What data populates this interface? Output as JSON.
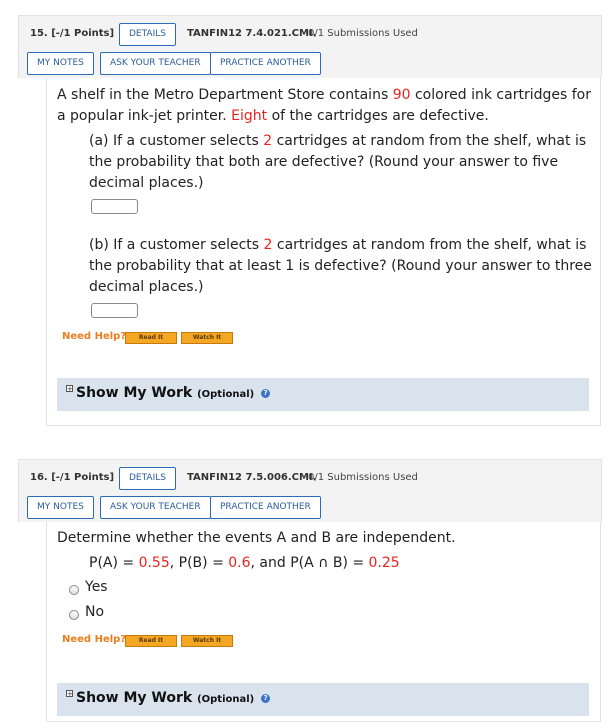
{
  "q15": {
    "number": "15.",
    "points": "[-/1 Points]",
    "details": "DETAILS",
    "code": "TANFIN12 7.4.021.CMI.",
    "submissions": "0/1 Submissions Used",
    "my_notes": "MY NOTES",
    "ask_teacher": "ASK YOUR TEACHER",
    "practice": "PRACTICE ANOTHER",
    "p1_a": "A shelf in the Metro Department Store contains ",
    "p1_num": "90",
    "p1_b": " colored ink cartridges for",
    "p2_a": "a popular ink-jet printer. ",
    "p2_num": "Eight",
    "p2_b": " of the cartridges are defective.",
    "a_line1_a": "(a) If a customer selects ",
    "a_line1_num": "2",
    "a_line1_b": " cartridges at random from the shelf, what is",
    "a_line2": "the probability that both are defective? (Round your answer to five",
    "a_line3": "decimal places.)",
    "b_line1_a": "(b) If a customer selects ",
    "b_line1_num": "2",
    "b_line1_b": " cartridges at random from the shelf, what is",
    "b_line2": "the probability that at least 1 is defective? (Round your answer to three",
    "b_line3": "decimal places.)",
    "need_help": "Need Help?",
    "read_it": "Read It",
    "watch_it": "Watch It",
    "show_work": "Show My Work",
    "optional": "(Optional)"
  },
  "q16": {
    "number": "16.",
    "points": "[-/1 Points]",
    "details": "DETAILS",
    "code": "TANFIN12 7.5.006.CMI.",
    "submissions": "0/1 Submissions Used",
    "my_notes": "MY NOTES",
    "ask_teacher": "ASK YOUR TEACHER",
    "practice": "PRACTICE ANOTHER",
    "prompt": "Determine whether the events A and B are independent.",
    "pa_label": "P(A) = ",
    "pa_val": "0.55",
    "pb_label": ", P(B) = ",
    "pb_val": "0.6",
    "pab_label": ", and P(A ∩ B) = ",
    "pab_val": "0.25",
    "opt_yes": "Yes",
    "opt_no": "No",
    "need_help": "Need Help?",
    "read_it": "Read It",
    "watch_it": "Watch It",
    "show_work": "Show My Work",
    "optional": "(Optional)"
  },
  "colors": {
    "accent": "#2b6cb8",
    "highlight": "#e8231e",
    "help": "#e87e1f",
    "work_bg": "#d9e3ee"
  }
}
